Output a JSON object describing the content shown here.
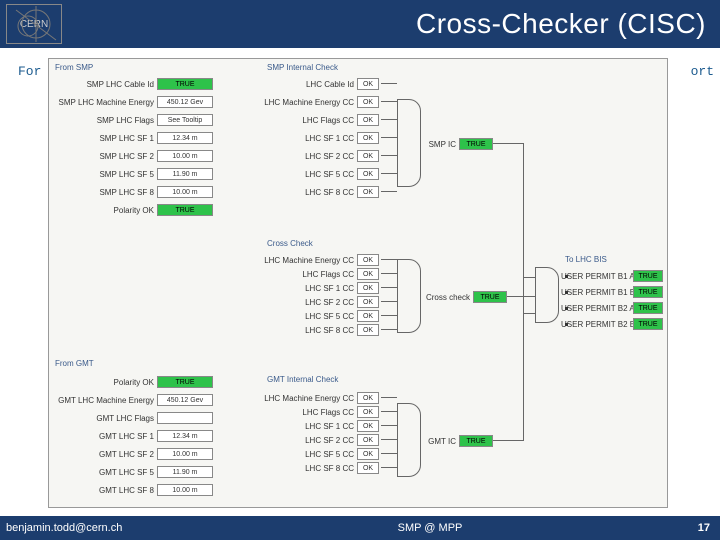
{
  "header": {
    "logo_text": "CERN",
    "title": "Cross-Checker (CISC)"
  },
  "bg": {
    "left": "For",
    "right": "ort"
  },
  "labels": {
    "from_smp": "From SMP",
    "smp_ic": "SMP Internal Check",
    "cross_check_sec": "Cross Check",
    "from_gmt": "From GMT",
    "gmt_ic": "GMT Internal Check",
    "to_bis": "To LHC BIS"
  },
  "smp_left": [
    {
      "l": "SMP LHC Cable Id",
      "v": "TRUE",
      "g": true
    },
    {
      "l": "SMP LHC Machine Energy",
      "v": "450.12 Gev"
    },
    {
      "l": "SMP LHC Flags",
      "v": "See Tooltip"
    },
    {
      "l": "SMP LHC SF 1",
      "v": "12.34 m"
    },
    {
      "l": "SMP LHC SF 2",
      "v": "10.00 m"
    },
    {
      "l": "SMP LHC SF 5",
      "v": "11.90 m"
    },
    {
      "l": "SMP LHC SF 8",
      "v": "10.00 m"
    },
    {
      "l": "Polarity OK",
      "v": "TRUE",
      "g": true
    }
  ],
  "smp_ic": [
    {
      "l": "LHC Cable Id",
      "v": "OK"
    },
    {
      "l": "LHC Machine Energy CC",
      "v": "OK"
    },
    {
      "l": "LHC Flags CC",
      "v": "OK"
    },
    {
      "l": "LHC SF 1 CC",
      "v": "OK"
    },
    {
      "l": "LHC SF 2 CC",
      "v": "OK"
    },
    {
      "l": "LHC SF 5 CC",
      "v": "OK"
    },
    {
      "l": "LHC SF 8 CC",
      "v": "OK"
    }
  ],
  "smp_ic_out": {
    "l": "SMP IC",
    "v": "TRUE"
  },
  "cross": [
    {
      "l": "LHC Machine Energy CC",
      "v": "OK"
    },
    {
      "l": "LHC Flags CC",
      "v": "OK"
    },
    {
      "l": "LHC SF 1 CC",
      "v": "OK"
    },
    {
      "l": "LHC SF 2 CC",
      "v": "OK"
    },
    {
      "l": "LHC SF 5 CC",
      "v": "OK"
    },
    {
      "l": "LHC SF 8 CC",
      "v": "OK"
    }
  ],
  "cross_out": {
    "l": "Cross check",
    "v": "TRUE"
  },
  "gmt_left": [
    {
      "l": "Polarity OK",
      "v": "TRUE",
      "g": true
    },
    {
      "l": "GMT LHC Machine Energy",
      "v": "450.12 Gev"
    },
    {
      "l": "GMT LHC Flags",
      "v": ""
    },
    {
      "l": "GMT LHC SF 1",
      "v": "12.34 m"
    },
    {
      "l": "GMT LHC SF 2",
      "v": "10.00 m"
    },
    {
      "l": "GMT LHC SF 5",
      "v": "11.90 m"
    },
    {
      "l": "GMT LHC SF 8",
      "v": "10.00 m"
    }
  ],
  "gmt_ic": [
    {
      "l": "LHC Machine Energy CC",
      "v": "OK"
    },
    {
      "l": "LHC Flags CC",
      "v": "OK"
    },
    {
      "l": "LHC SF 1 CC",
      "v": "OK"
    },
    {
      "l": "LHC SF 2 CC",
      "v": "OK"
    },
    {
      "l": "LHC SF 5 CC",
      "v": "OK"
    },
    {
      "l": "LHC SF 8 CC",
      "v": "OK"
    }
  ],
  "gmt_ic_out": {
    "l": "GMT IC",
    "v": "TRUE"
  },
  "permits": [
    {
      "l": "USER PERMIT B1 A",
      "v": "TRUE"
    },
    {
      "l": "USER PERMIT B1 B",
      "v": "TRUE"
    },
    {
      "l": "USER PERMIT B2 A",
      "v": "TRUE"
    },
    {
      "l": "USER PERMIT B2 B",
      "v": "TRUE"
    }
  ],
  "footer": {
    "email": "benjamin.todd@cern.ch",
    "mid": "SMP @ MPP",
    "page": "17"
  }
}
